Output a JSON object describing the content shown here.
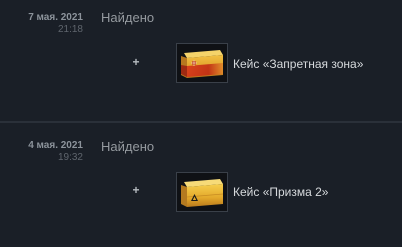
{
  "history": [
    {
      "date": "7 мая. 2021",
      "time": "21:18",
      "event": "Найдено",
      "plus": "+",
      "item": {
        "name": "Кейс «Запретная зона»",
        "icon": "danger-zone-case-icon",
        "color": "#c8351a"
      }
    },
    {
      "date": "4 мая. 2021",
      "time": "19:32",
      "event": "Найдено",
      "plus": "+",
      "item": {
        "name": "Кейс «Призма 2»",
        "icon": "prisma-2-case-icon",
        "color": "#e0a526"
      }
    }
  ]
}
